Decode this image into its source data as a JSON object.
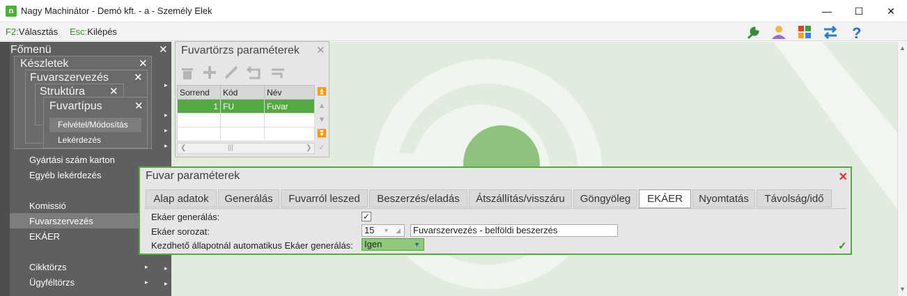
{
  "window": {
    "title": "Nagy Machinátor - Demó kft. - a - Személy Elek",
    "logo_letter": "n",
    "minimize": "—",
    "maximize": "☐",
    "close": "✕"
  },
  "shortcuts": [
    {
      "key": "F2:",
      "label": "Választás"
    },
    {
      "key": "Esc:",
      "label": "Kilépés"
    }
  ],
  "toolbar_icons": [
    "wrench-icon",
    "user-icon",
    "apps-icon",
    "swap-icon",
    "help-icon"
  ],
  "main_menu": {
    "title": "Főmenü",
    "close": "✕",
    "submenus": [
      {
        "title": "Készletek",
        "close": "✕"
      },
      {
        "title": "Fuvarszervezés",
        "close": "✕"
      },
      {
        "title": "Struktúra",
        "close": "✕"
      },
      {
        "title": "Fuvartípus",
        "close": "✕"
      }
    ],
    "fuvartipus_items": [
      "Felvétel/Módosítás",
      "Lekérdezés"
    ],
    "items": [
      {
        "label": "Gyártási szám karton"
      },
      {
        "label": "Egyéb lekérdezés"
      },
      {
        "label": "Komissió"
      },
      {
        "label": "Fuvarszervezés"
      },
      {
        "label": "EKÁER"
      },
      {
        "label": "Cikktörzs"
      },
      {
        "label": "Ügyféltörzs"
      }
    ]
  },
  "fuvartorzs_panel": {
    "title": "Fuvartörzs paraméterek",
    "close": "✕",
    "columns": [
      "Sorrend",
      "Kód",
      "Név"
    ],
    "rows": [
      [
        "1",
        "FU",
        "Fuvar"
      ],
      [
        "",
        "",
        ""
      ],
      [
        "",
        "",
        ""
      ]
    ],
    "scroll_glyph": "|||"
  },
  "dialog": {
    "title": "Fuvar paraméterek",
    "close": "✕",
    "tabs": [
      "Alap adatok",
      "Generálás",
      "Fuvarról leszed",
      "Beszerzés/eladás",
      "Átszállítás/visszáru",
      "Göngyöleg",
      "EKÁER",
      "Nyomtatás",
      "Távolság/idő"
    ],
    "active_tab": "EKÁER",
    "fields": {
      "generalas_label": "Ekáer generálás:",
      "generalas_checked": "✓",
      "sorozat_label": "Ekáer sorozat:",
      "sorozat_value": "15",
      "sorozat_name": "Fuvarszervezés - belföldi beszerzés",
      "auto_label": "Kezdhető állapotnál automatikus Ekáer generálás:",
      "auto_value": "Igen"
    },
    "ok_glyph": "✓"
  },
  "colors": {
    "accent": "#56a843",
    "desktop": "#e1ecde",
    "menu": "#5f5f5f"
  }
}
